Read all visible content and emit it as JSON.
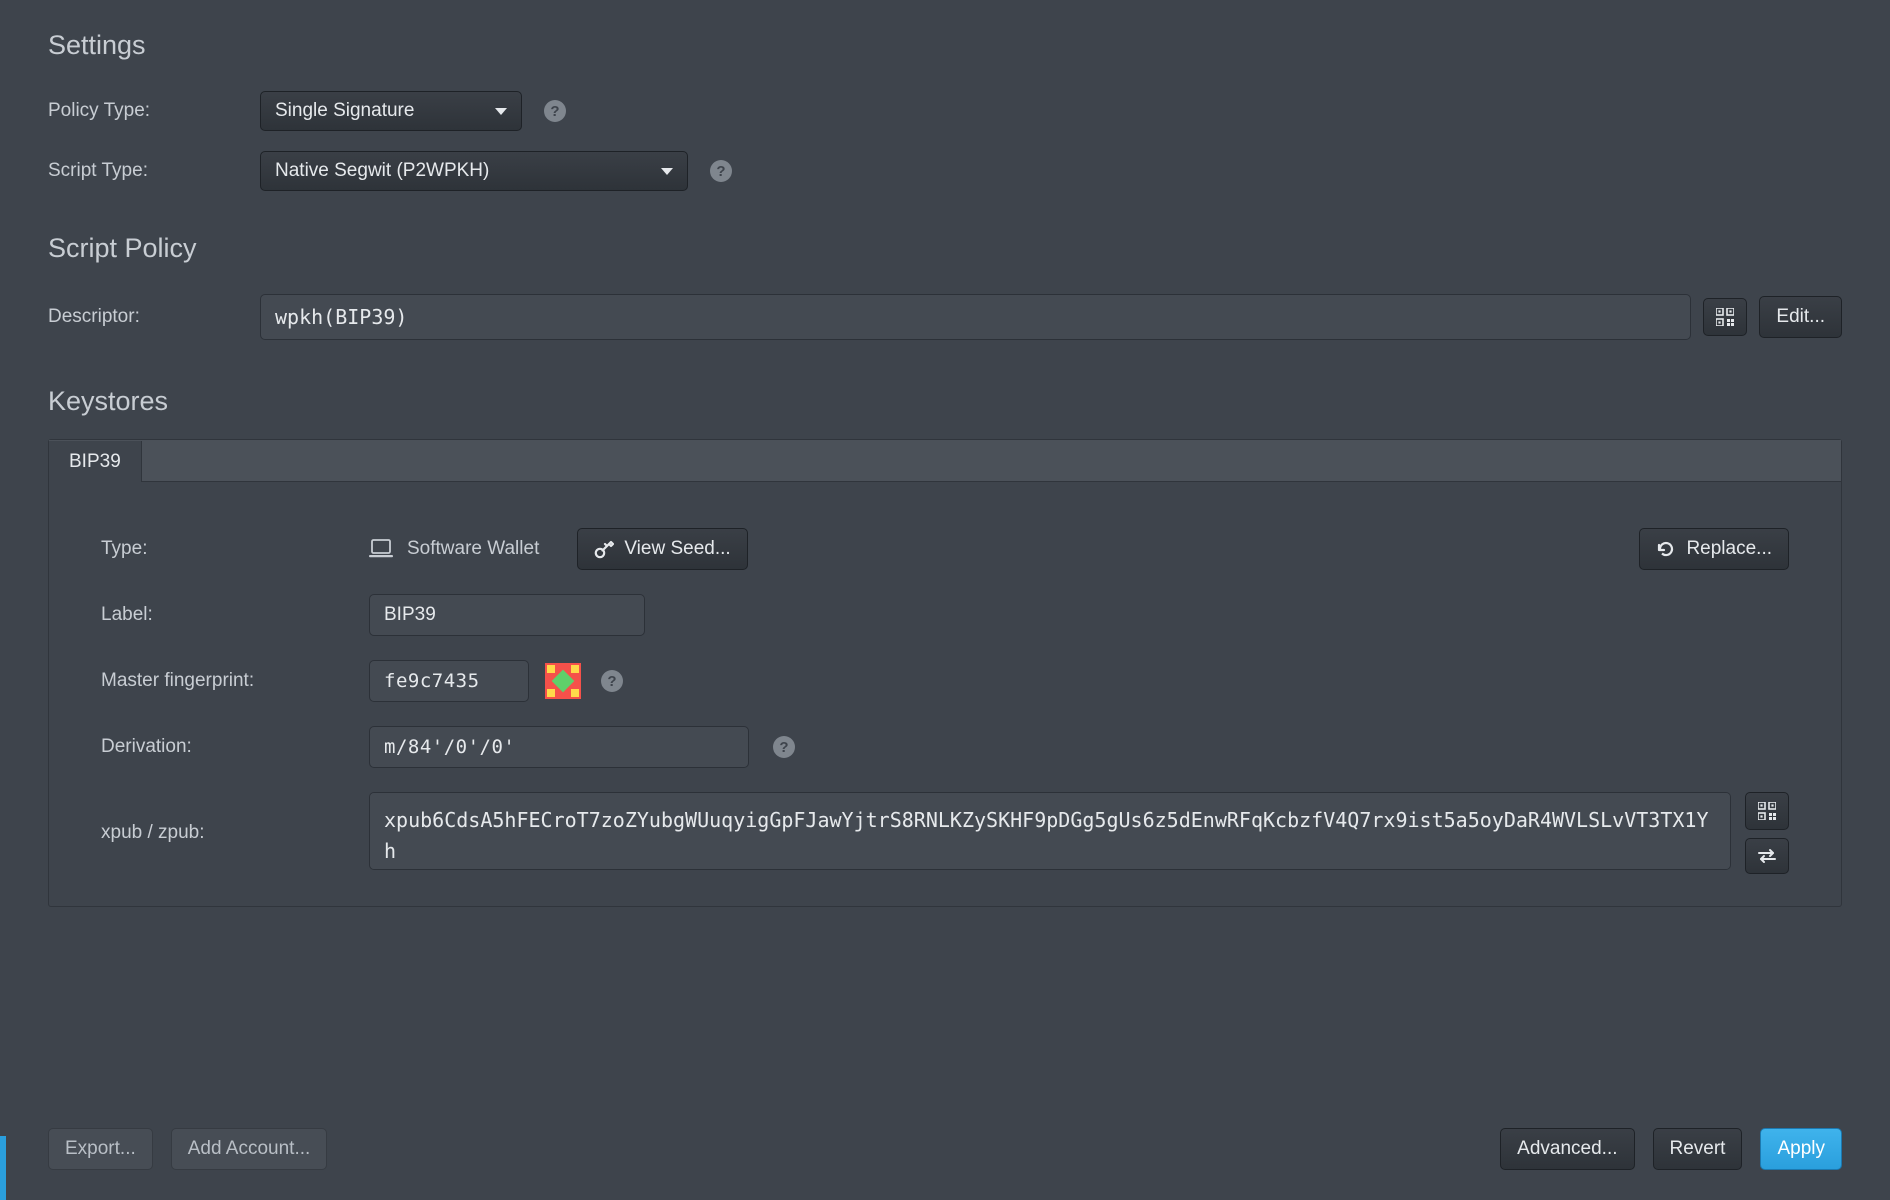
{
  "settings": {
    "title": "Settings",
    "policy_type_label": "Policy Type:",
    "policy_type_value": "Single Signature",
    "script_type_label": "Script Type:",
    "script_type_value": "Native Segwit (P2WPKH)"
  },
  "script_policy": {
    "title": "Script Policy",
    "descriptor_label": "Descriptor:",
    "descriptor_value": "wpkh(BIP39)",
    "edit_label": "Edit..."
  },
  "keystores": {
    "title": "Keystores",
    "tab_label": "BIP39",
    "type_label": "Type:",
    "type_value": "Software Wallet",
    "view_seed_label": "View Seed...",
    "replace_label": "Replace...",
    "label_label": "Label:",
    "label_value": "BIP39",
    "fingerprint_label": "Master fingerprint:",
    "fingerprint_value": "fe9c7435",
    "derivation_label": "Derivation:",
    "derivation_value": "m/84'/0'/0'",
    "xpub_label": "xpub / zpub:",
    "xpub_value": "xpub6CdsA5hFECroT7zoZYubgWUuqyigGpFJawYjtrS8RNLKZySKHF9pDGg5gUs6z5dEnwRFqKcbzfV4Q7rx9ist5a5oyDaR4WVLSLvVT3TX1Yh"
  },
  "footer": {
    "export_label": "Export...",
    "add_account_label": "Add Account...",
    "advanced_label": "Advanced...",
    "revert_label": "Revert",
    "apply_label": "Apply"
  }
}
